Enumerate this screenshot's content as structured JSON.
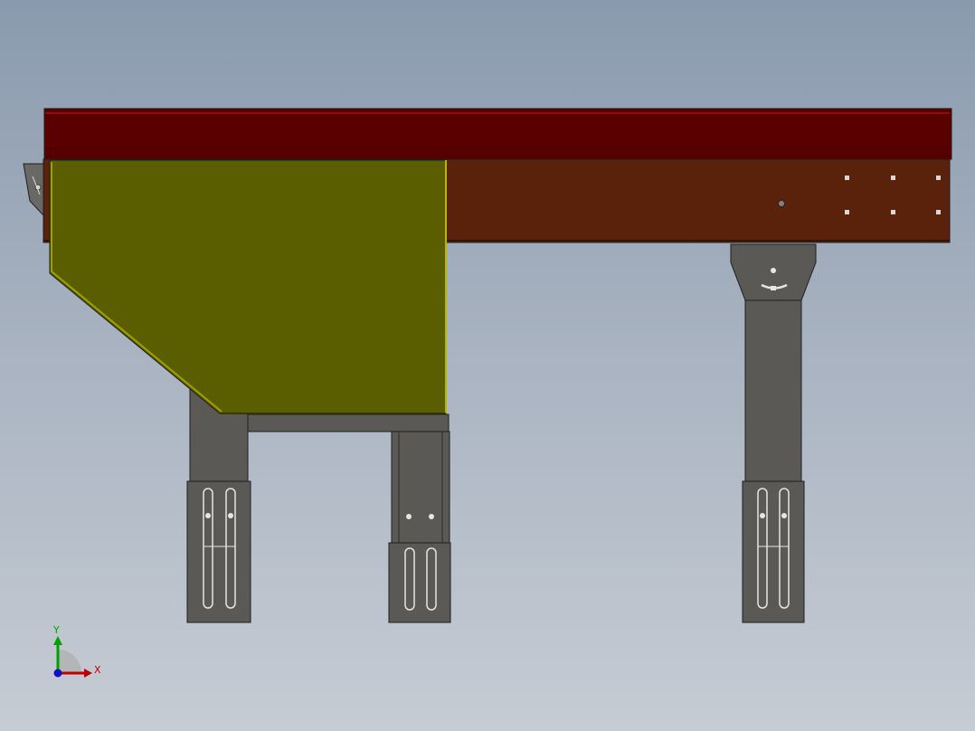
{
  "triad": {
    "x_label": "X",
    "y_label": "Y"
  },
  "colors": {
    "background_top": "#8a9aae",
    "background_bottom": "#c6ccd4",
    "top_belt": "#5a0000",
    "frame_rail": "#5a220a",
    "guard_panel": "#5a5e00",
    "leg_metal": "#5b5955",
    "edge_line": "#1e1e1e",
    "axis_x": "#c00000",
    "axis_y": "#00a000",
    "axis_z": "#1010c0"
  }
}
